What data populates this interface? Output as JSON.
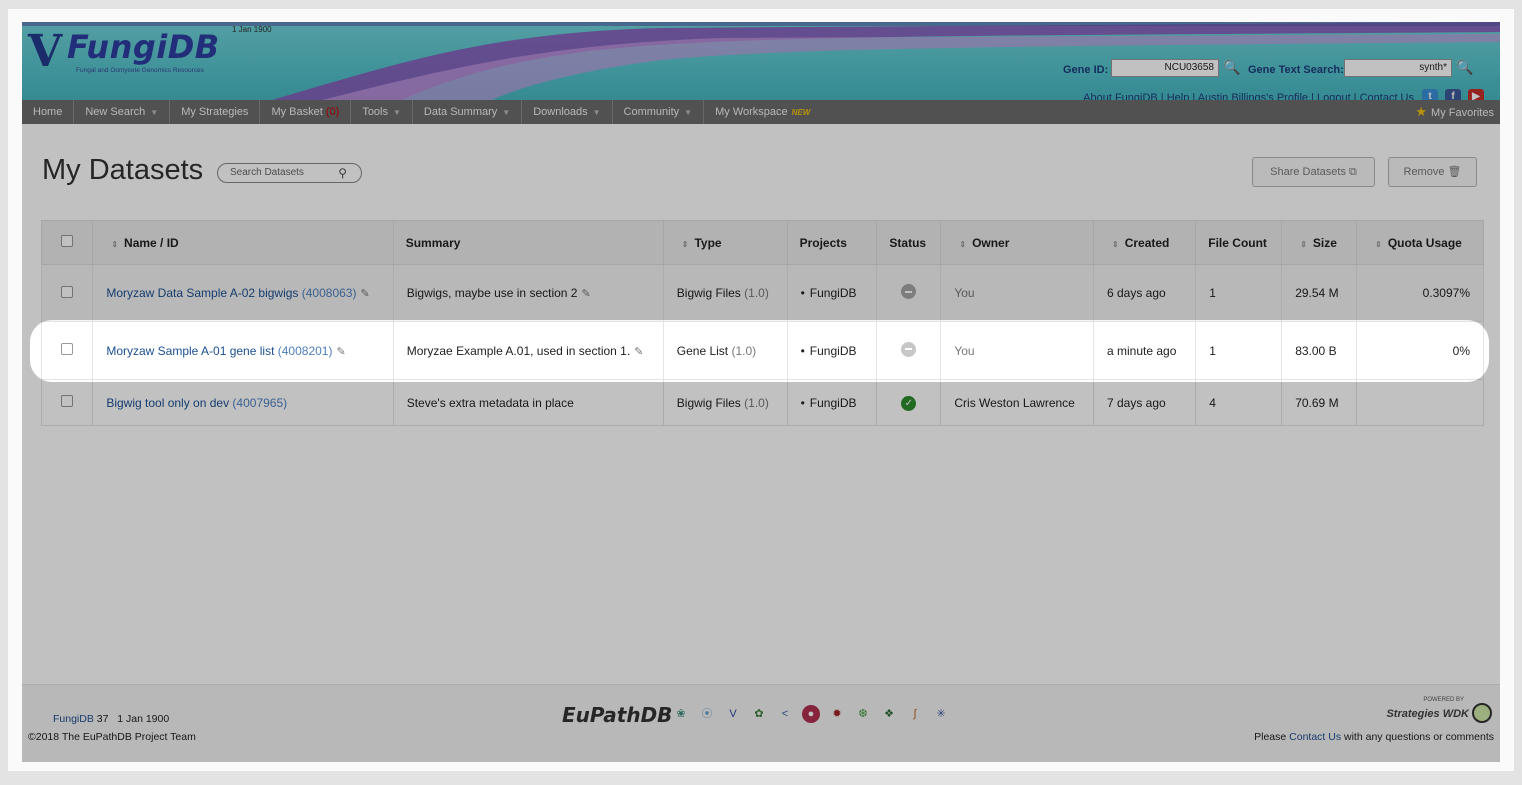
{
  "site": {
    "logo_text": "FungiDB",
    "logo_v": "V",
    "logo_date": "1 Jan 1900",
    "tagline": "Fungal and Oomycete Genomics Resources"
  },
  "header": {
    "gene_id_label": "Gene ID:",
    "gene_id_value": "NCU03658",
    "gene_text_label": "Gene Text Search:",
    "gene_text_value": "synth*",
    "links": "About FungiDB | Help | Austin Billings's Profile | Logout | Contact Us",
    "social": [
      "twitter-icon",
      "facebook-icon",
      "youtube-icon"
    ]
  },
  "nav": {
    "items": [
      {
        "label": "Home",
        "caret": false
      },
      {
        "label": "New Search",
        "caret": true
      },
      {
        "label": "My Strategies",
        "caret": false
      },
      {
        "label": "My Basket",
        "badge": "(0)",
        "caret": false
      },
      {
        "label": "Tools",
        "caret": true
      },
      {
        "label": "Data Summary",
        "caret": true
      },
      {
        "label": "Downloads",
        "caret": true
      },
      {
        "label": "Community",
        "caret": true
      },
      {
        "label": "My Workspace",
        "new": "NEW",
        "caret": false
      }
    ],
    "favorites": "My Favorites"
  },
  "main": {
    "title": "My Datasets",
    "search_placeholder": "Search Datasets",
    "share_button": "Share Datasets",
    "remove_button": "Remove"
  },
  "table": {
    "columns": [
      "Name / ID",
      "Summary",
      "Type",
      "Projects",
      "Status",
      "Owner",
      "Created",
      "File Count",
      "Size",
      "Quota Usage"
    ],
    "rows": [
      {
        "name": "Moryzaw Data Sample A-02 bigwigs",
        "id": "(4008063)",
        "summary": "Bigwigs, maybe use in section 2",
        "type": "Bigwig Files",
        "type_version": "(1.0)",
        "project": "FungiDB",
        "status": "pending",
        "owner": "You",
        "created": "6 days ago",
        "file_count": "1",
        "size": "29.54 M",
        "quota": "0.3097%"
      },
      {
        "name": "Moryzaw Sample A-01 gene list",
        "id": "(4008201)",
        "summary": "Moryzae Example A.01, used in section 1.",
        "type": "Gene List",
        "type_version": "(1.0)",
        "project": "FungiDB",
        "status": "pending",
        "owner": "You",
        "created": "a minute ago",
        "file_count": "1",
        "size": "83.00 B",
        "quota": "0%"
      },
      {
        "name": "Bigwig tool only on dev",
        "id": "(4007965)",
        "summary": "Steve's extra metadata in place",
        "type": "Bigwig Files",
        "type_version": "(1.0)",
        "project": "FungiDB",
        "status": "complete",
        "owner": "Cris Weston Lawrence",
        "created": "7 days ago",
        "file_count": "4",
        "size": "70.69 M",
        "quota": ""
      }
    ]
  },
  "footer": {
    "site_name": "FungiDB",
    "release": "37",
    "date": "1 Jan 1900",
    "copyright": "©2018 The EuPathDB Project Team",
    "eupath": "EuPathDB",
    "powered_by": "POWERED BY",
    "wdk": "Strategies WDK",
    "contact_prefix": "Please",
    "contact_link": "Contact Us",
    "contact_suffix": "with any questions or comments"
  },
  "colors": {
    "nav_bg": "#6b6b6b",
    "link": "#1d4f91",
    "banner": "#56c3cc",
    "status_ok": "#2e8b2e",
    "status_pending": "#a5a5a5"
  }
}
